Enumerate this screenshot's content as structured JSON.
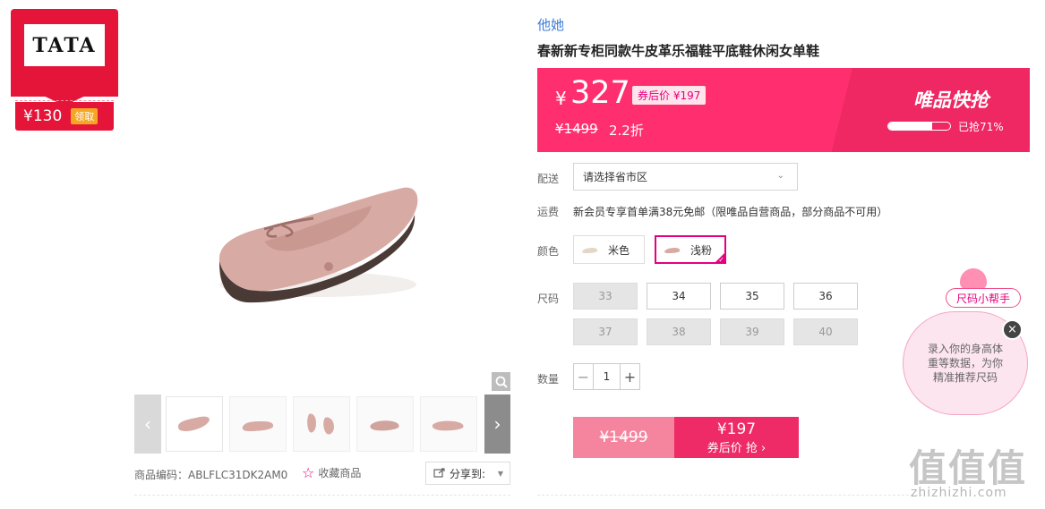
{
  "coupon": {
    "logo": "TATA",
    "price": "¥130",
    "action": "领取"
  },
  "product": {
    "brand": "他她",
    "title": "春新新专柜同款牛皮革乐福鞋平底鞋休闲女单鞋",
    "code": "商品编码：ABLFLC31DK2AM0",
    "favorite": "收藏商品",
    "share": "分享到:"
  },
  "price": {
    "yen": "¥",
    "current": "327",
    "after_coupon": "券后价 ¥197",
    "original": "¥1499",
    "discount": "2.2折",
    "promo_title": "唯品快抢",
    "sold_percent_text": "已抢71%",
    "sold_fraction": 0.71
  },
  "delivery": {
    "label": "配送",
    "placeholder": "请选择省市区"
  },
  "shipping": {
    "label": "运费",
    "text": "新会员专享首单满38元免邮（限唯品自营商品，部分商品不可用）"
  },
  "color": {
    "label": "颜色",
    "options": [
      {
        "label": "米色",
        "selected": false
      },
      {
        "label": "浅粉",
        "selected": true
      }
    ]
  },
  "size": {
    "label": "尺码",
    "options": [
      {
        "label": "33",
        "available": false
      },
      {
        "label": "34",
        "available": true
      },
      {
        "label": "35",
        "available": true
      },
      {
        "label": "36",
        "available": true
      },
      {
        "label": "37",
        "available": false
      },
      {
        "label": "38",
        "available": false
      },
      {
        "label": "39",
        "available": false
      },
      {
        "label": "40",
        "available": false
      }
    ]
  },
  "quantity": {
    "label": "数量",
    "value": "1",
    "minus": "−",
    "plus": "+"
  },
  "buy": {
    "original": "¥1499",
    "price": "¥197",
    "label": "券后价 抢 ›"
  },
  "helper": {
    "tag": "尺码小帮手",
    "text": "录入你的身高体重等数据，为你精准推荐尺码",
    "close": "×"
  },
  "watermark": {
    "text": "值值值",
    "url": "zhizhizhi.com"
  },
  "colors": {
    "accent": "#e4007f",
    "banner": "#ff2e6e",
    "coupon_red": "#e5153a",
    "brand_blue": "#3a7bd5"
  },
  "icons": {
    "zoom": "magnifier-icon",
    "share": "share-icon",
    "favorite": "star-icon",
    "prev": "chevron-left-icon",
    "next": "chevron-right-icon"
  }
}
